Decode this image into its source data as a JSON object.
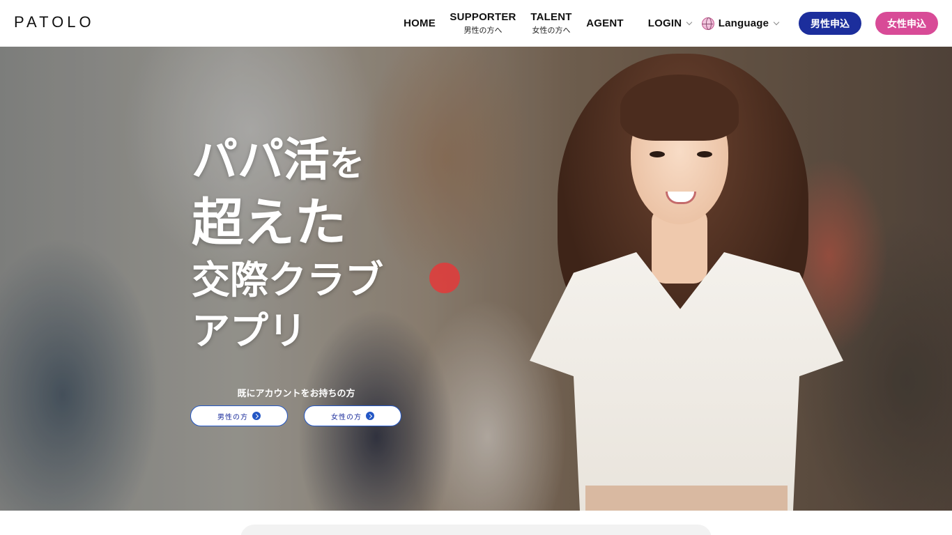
{
  "header": {
    "logo": "PATOLO",
    "nav": [
      {
        "label": "HOME",
        "sub": ""
      },
      {
        "label": "SUPPORTER",
        "sub": "男性の方へ"
      },
      {
        "label": "TALENT",
        "sub": "女性の方へ"
      },
      {
        "label": "AGENT",
        "sub": ""
      },
      {
        "label": "LOGIN",
        "sub": ""
      }
    ],
    "language": "Language",
    "apply_male": "男性申込",
    "apply_female": "女性申込"
  },
  "hero": {
    "title_1a": "パパ活",
    "title_1b": "を",
    "title_2": "超えた",
    "title_3": "交際クラブ",
    "title_4": "アプリ",
    "have_account": "既にアカウントをお持ちの方",
    "male_button": "男性の方",
    "female_button": "女性の方"
  },
  "colors": {
    "male_accent": "#1c2e9c",
    "female_accent": "#d84b97",
    "link_blue": "#2457c5"
  }
}
